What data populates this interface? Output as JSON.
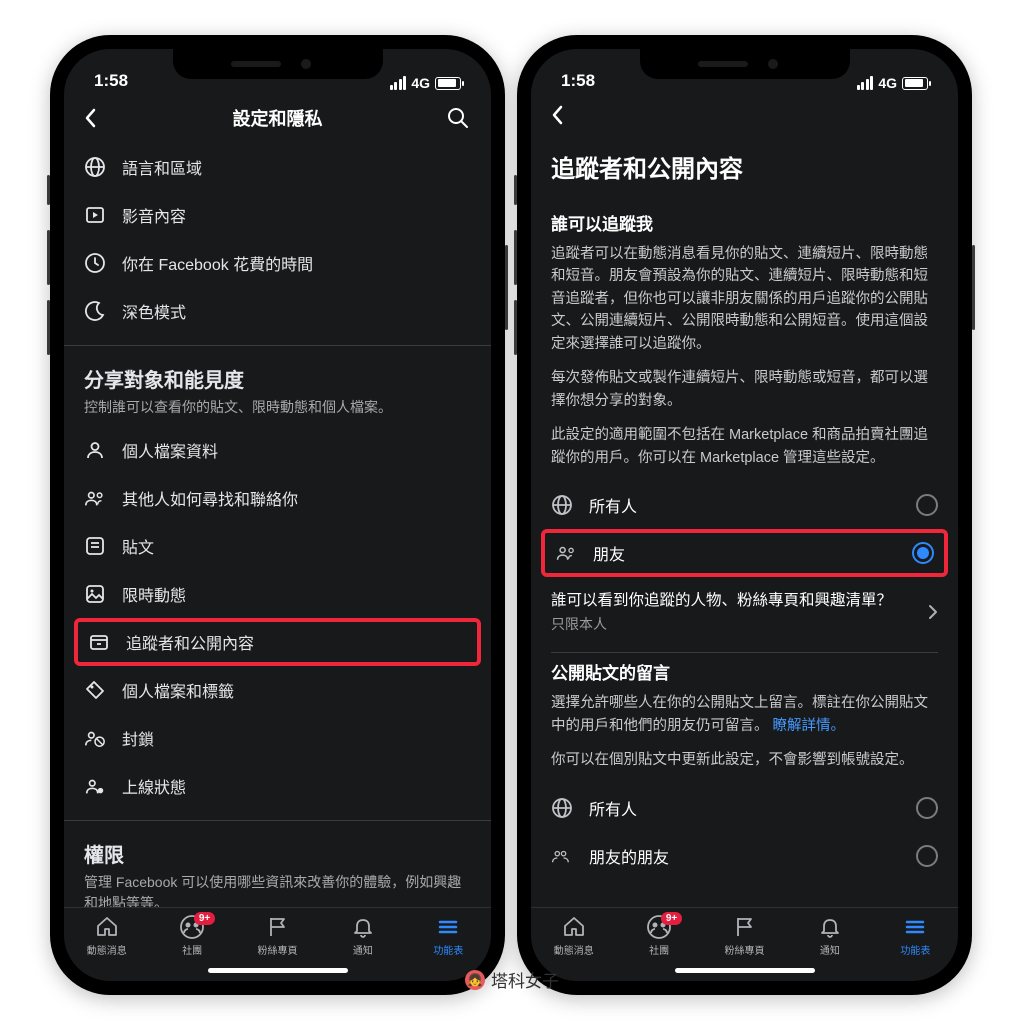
{
  "status": {
    "time": "1:58",
    "network": "4G"
  },
  "left": {
    "title": "設定和隱私",
    "group1": [
      {
        "icon": "globe-icon",
        "label": "語言和區域"
      },
      {
        "icon": "video-icon",
        "label": "影音內容"
      },
      {
        "icon": "clock-icon",
        "label": "你在 Facebook 花費的時間"
      },
      {
        "icon": "moon-icon",
        "label": "深色模式"
      }
    ],
    "section2_title": "分享對象和能見度",
    "section2_sub": "控制誰可以查看你的貼文、限時動態和個人檔案。",
    "group2": [
      {
        "icon": "person-icon",
        "label": "個人檔案資料"
      },
      {
        "icon": "people-plus-icon",
        "label": "其他人如何尋找和聯絡你"
      },
      {
        "icon": "post-icon",
        "label": "貼文"
      },
      {
        "icon": "image-icon",
        "label": "限時動態"
      },
      {
        "icon": "archive-icon",
        "label": "追蹤者和公開內容",
        "hl": true
      },
      {
        "icon": "tag-icon",
        "label": "個人檔案和標籤"
      },
      {
        "icon": "block-icon",
        "label": "封鎖"
      },
      {
        "icon": "active-icon",
        "label": "上線狀態"
      }
    ],
    "section3_title": "權限",
    "section3_sub": "管理 Facebook 可以使用哪些資訊來改善你的體驗，例如興趣和地點等等。"
  },
  "right": {
    "page_title": "追蹤者和公開內容",
    "sh1": "誰可以追蹤我",
    "p1": "追蹤者可以在動態消息看見你的貼文、連續短片、限時動態和短音。朋友會預設為你的貼文、連續短片、限時動態和短音追蹤者，但你也可以讓非朋友關係的用戶追蹤你的公開貼文、公開連續短片、公開限時動態和公開短音。使用這個設定來選擇誰可以追蹤你。",
    "p2": "每次發佈貼文或製作連續短片、限時動態或短音，都可以選擇你想分享的對象。",
    "p3": "此設定的適用範圍不包括在 Marketplace 和商品拍賣社團追蹤你的用戶。你可以在 Marketplace 管理這些設定。",
    "opt_public": "所有人",
    "opt_friends": "朋友",
    "nav1_title": "誰可以看到你追蹤的人物、粉絲專頁和興趣清單？",
    "nav1_sub": "只限本人",
    "sh2": "公開貼文的留言",
    "p4": "選擇允許哪些人在你的公開貼文上留言。標註在你公開貼文中的用戶和他們的朋友仍可留言。",
    "p4_link": "瞭解詳情。",
    "p5": "你可以在個別貼文中更新此設定，不會影響到帳號設定。",
    "opt_public2": "所有人",
    "opt_fof": "朋友的朋友"
  },
  "tabs": [
    {
      "name": "home",
      "label": "動態消息"
    },
    {
      "name": "groups",
      "label": "社團",
      "badge": "9+"
    },
    {
      "name": "pages",
      "label": "粉絲專頁"
    },
    {
      "name": "notif",
      "label": "通知"
    },
    {
      "name": "menu",
      "label": "功能表",
      "active": true
    }
  ],
  "watermark": "塔科女子"
}
